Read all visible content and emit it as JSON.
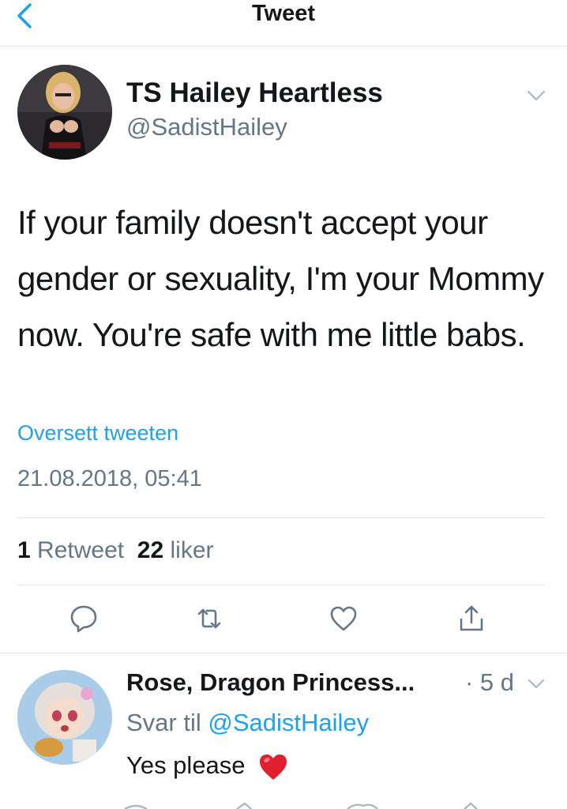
{
  "nav": {
    "title": "Tweet",
    "back_icon": "chevron-left-icon"
  },
  "tweet": {
    "author_name": "TS Hailey Heartless",
    "author_handle": "@SadistHailey",
    "text": "If your family doesn't accept your gender or sexuality, I'm your Mommy now. You're safe with me little babs.",
    "translate_label": "Oversett tweeten",
    "timestamp": "21.08.2018, 05:41",
    "retweet_count": "1",
    "retweet_label": "Retweet",
    "like_count": "22",
    "like_label": "liker",
    "actions": [
      "reply-icon",
      "retweet-icon",
      "like-icon",
      "share-icon"
    ]
  },
  "reply": {
    "author_name": "Rose, Dragon Princess...",
    "time": "· 5 d",
    "replying_to_label": "Svar til",
    "replying_to_handle": "@SadistHailey",
    "text": "Yes please",
    "emoji": "red-heart-emoji"
  },
  "colors": {
    "accent": "#1da1f2",
    "muted": "#657786",
    "text": "#14171a",
    "divider": "#e1e8ed"
  }
}
